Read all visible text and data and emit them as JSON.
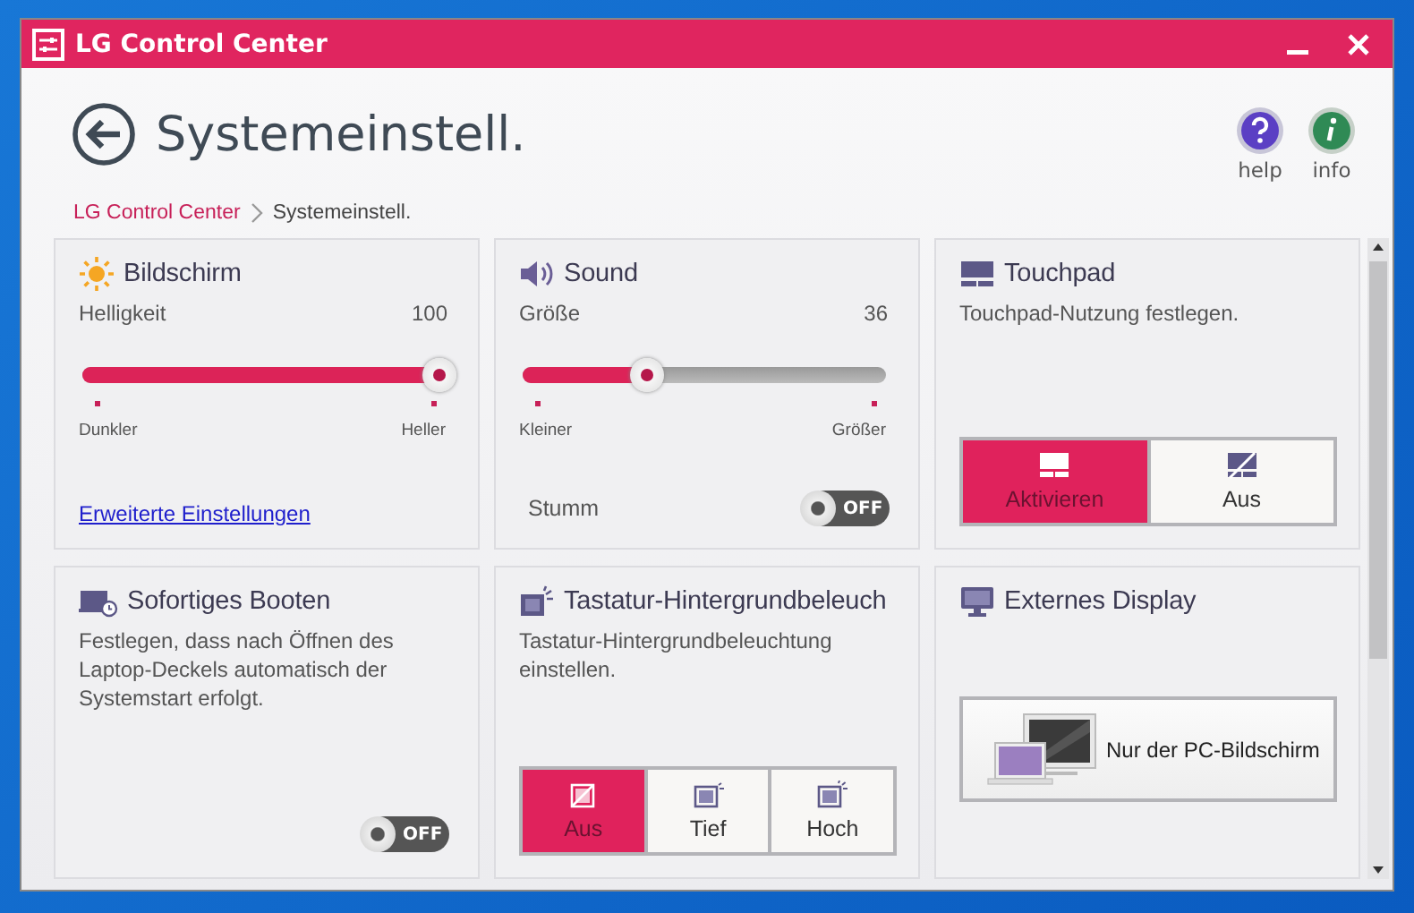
{
  "window": {
    "title": "LG Control Center"
  },
  "header": {
    "title": "Systemeinstell.",
    "actions": [
      {
        "kind": "help",
        "label": "help"
      },
      {
        "kind": "info",
        "label": "info"
      }
    ]
  },
  "breadcrumb": [
    {
      "label": "LG Control Center",
      "selected": false
    },
    {
      "label": "Systemeinstell.",
      "selected": true
    }
  ],
  "cards": [
    {
      "kind": "slider",
      "title": "Bildschirm",
      "label": "Helligkeit",
      "value": "100",
      "level": 1,
      "min_label": "Dunkler",
      "max_label": "Heller",
      "link": "Erweiterte Einstellungen"
    },
    {
      "kind": "slider",
      "title": "Sound",
      "label": "Größe",
      "value": "36",
      "level": 0.36,
      "min_label": "Kleiner",
      "max_label": "Größer",
      "toggle": {
        "label": "Stumm",
        "on": false,
        "text": "OFF"
      }
    },
    {
      "kind": "segments",
      "title": "Touchpad",
      "description": "Touchpad-Nutzung festlegen.",
      "options": [
        {
          "label": "Aktivieren",
          "selected": true
        },
        {
          "label": "Aus",
          "selected": false
        }
      ]
    },
    {
      "kind": "toggle",
      "title": "Sofortiges Booten",
      "description": "Festlegen, dass nach Öffnen des Laptop-Deckels automatisch der Systemstart erfolgt.",
      "toggle": {
        "on": false,
        "text": "OFF"
      }
    },
    {
      "kind": "segments",
      "title": "Tastatur-Hintergrundbeleuch",
      "description": "Tastatur-Hintergrundbeleuchtung einstellen.",
      "options": [
        {
          "label": "Aus",
          "selected": true
        },
        {
          "label": "Tief",
          "selected": false
        },
        {
          "label": "Hoch",
          "selected": false
        }
      ]
    },
    {
      "kind": "display",
      "title": "Externes Display",
      "button": "Nur der PC-Bildschirm"
    }
  ]
}
